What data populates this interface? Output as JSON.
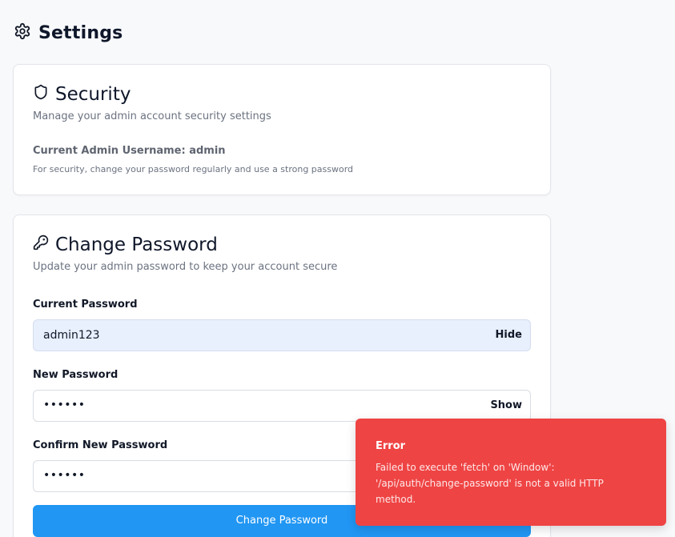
{
  "header": {
    "title": "Settings",
    "icon": "gear-icon"
  },
  "security": {
    "icon": "shield-icon",
    "title": "Security",
    "description": "Manage your admin account security settings",
    "admin_username_line": "Current Admin Username: admin",
    "hint": "For security, change your password regularly and use a strong password"
  },
  "change_password": {
    "icon": "key-icon",
    "title": "Change Password",
    "description": "Update your admin password to keep your account secure",
    "current": {
      "label": "Current Password",
      "value": "admin123",
      "toggle": "Hide"
    },
    "new": {
      "label": "New Password",
      "value": "••••••",
      "toggle": "Show"
    },
    "confirm": {
      "label": "Confirm New Password",
      "value": "••••••"
    },
    "submit_label": "Change Password"
  },
  "toast": {
    "title": "Error",
    "message": "Failed to execute 'fetch' on 'Window': '/api/auth/change-password' is not a valid HTTP method."
  },
  "colors": {
    "primary": "#2196f3",
    "error": "#ef4444",
    "filled_input": "#e8effd"
  }
}
